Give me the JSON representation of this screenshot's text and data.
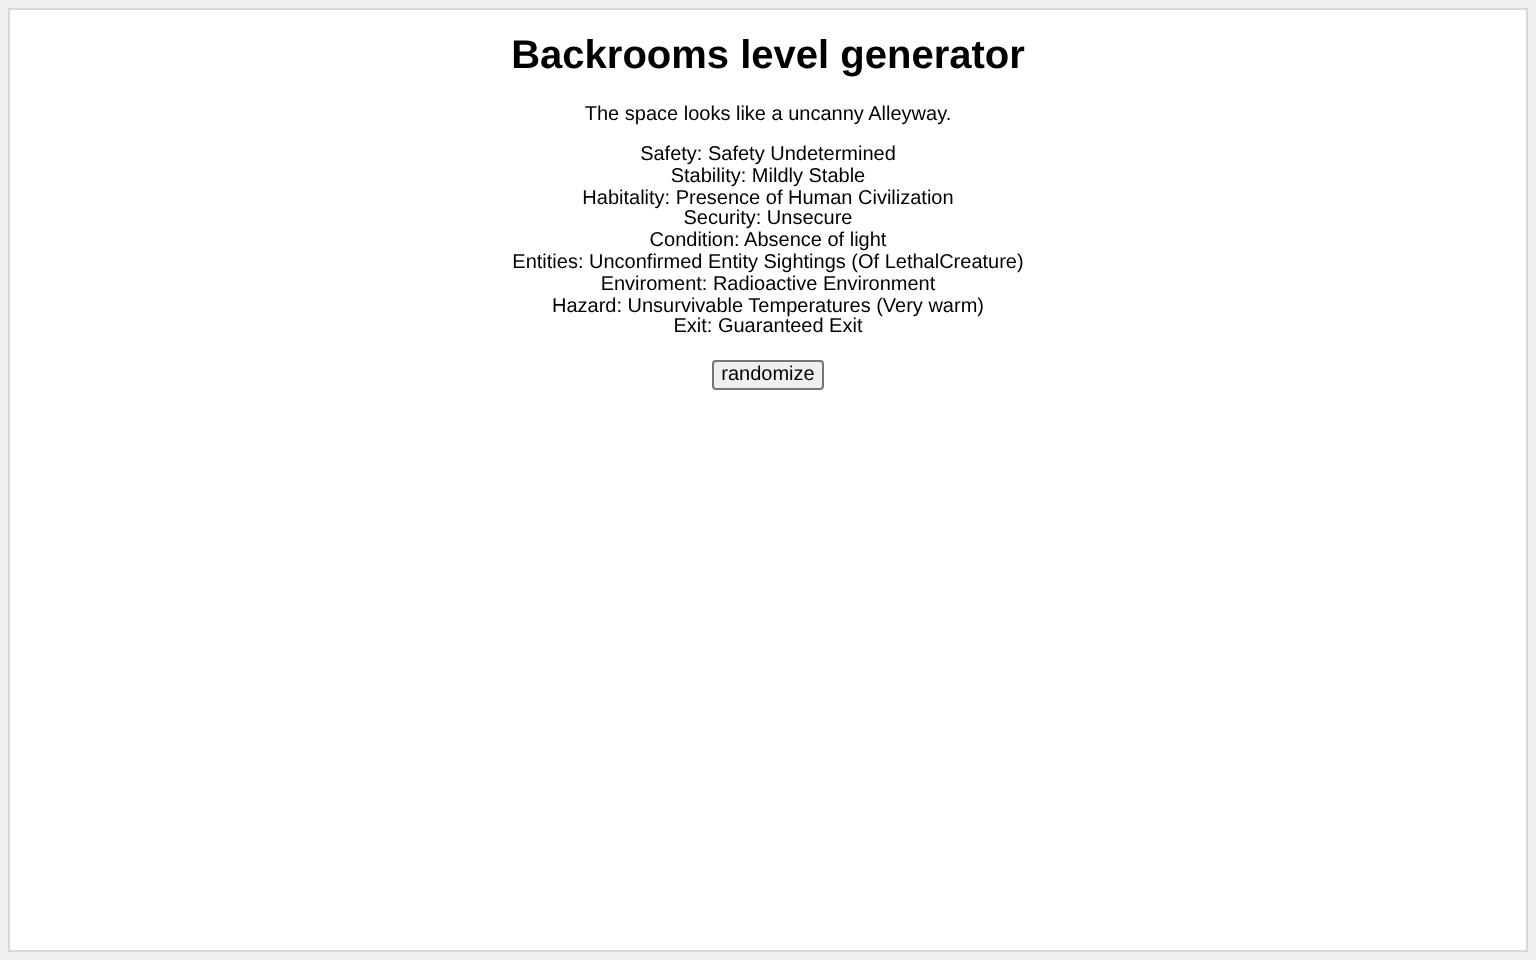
{
  "title": "Backrooms level generator",
  "description": "The space looks like a uncanny Alleyway.",
  "attributes": [
    "Safety: Safety Undetermined",
    "Stability: Mildly Stable",
    "Habitality: Presence of Human Civilization",
    "Security: Unsecure",
    "Condition: Absence of light",
    "Entities: Unconfirmed Entity Sightings (Of LethalCreature)",
    "Enviroment: Radioactive Environment",
    "Hazard: Unsurvivable Temperatures (Very warm)",
    "Exit: Guaranteed Exit"
  ],
  "button": "randomize"
}
